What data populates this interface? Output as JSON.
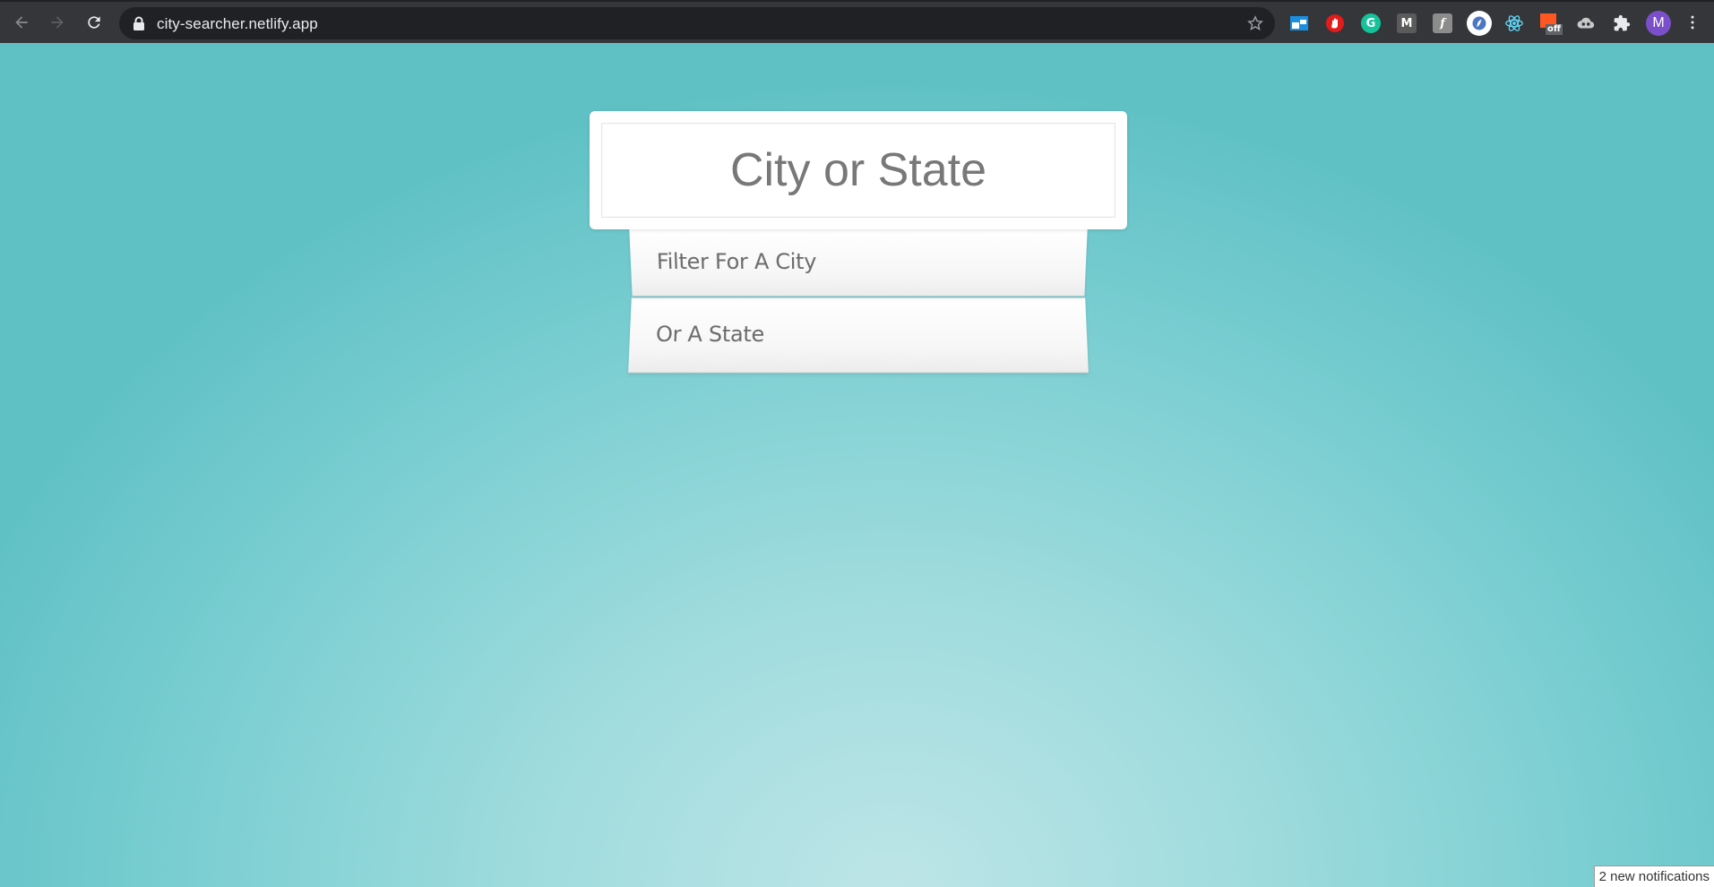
{
  "browser": {
    "url": "city-searcher.netlify.app",
    "extensions": [
      {
        "name": "raindrop-icon",
        "label": "",
        "color": "#1a8fe0"
      },
      {
        "name": "adblock-icon",
        "label": "",
        "color": "#e21b1b"
      },
      {
        "name": "grammarly-icon",
        "label": "G",
        "color": "#15c39a"
      },
      {
        "name": "mercury-icon",
        "label": "M",
        "color": "#5b5b5b"
      },
      {
        "name": "frame-icon",
        "label": "f",
        "color": "#8c8c8c"
      },
      {
        "name": "loom-icon",
        "label": "",
        "color": "#ffffff"
      },
      {
        "name": "react-devtools-icon",
        "label": "",
        "color": "#61dafb"
      },
      {
        "name": "rss-off-icon",
        "label": "off",
        "color": "#ff5722"
      },
      {
        "name": "cloud-icon",
        "label": "",
        "color": "#c8c8c8"
      },
      {
        "name": "puzzle-icon",
        "label": "",
        "color": "#c8c8c8"
      }
    ],
    "profile_initial": "M",
    "profile_color": "#7b4fc9"
  },
  "app": {
    "search_placeholder": "City or State",
    "suggestions": [
      {
        "label": "Filter For A City"
      },
      {
        "label": "Or A State"
      }
    ]
  },
  "notification": {
    "text": "2 new notifications"
  },
  "colors": {
    "background_center": "#bde5e7",
    "background_edge": "#60c1c5",
    "toolbar": "#35363a",
    "omnibox": "#202124"
  }
}
